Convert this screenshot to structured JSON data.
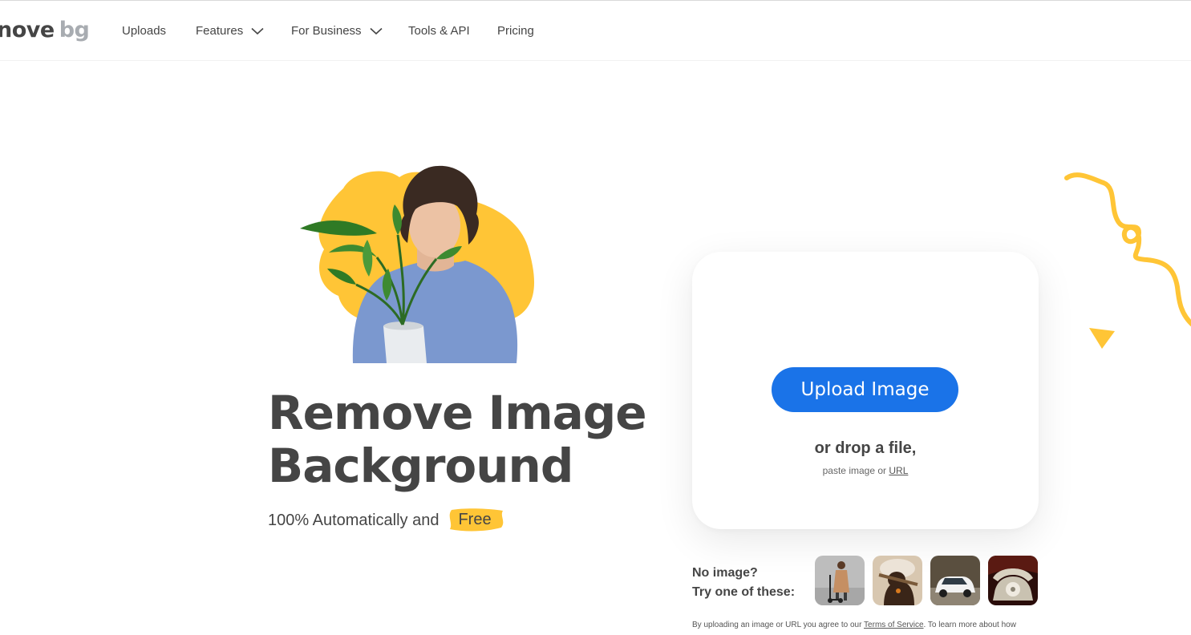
{
  "header": {
    "logo_main": "nove",
    "logo_accent": "bg",
    "nav": [
      {
        "label": "Uploads",
        "has_dropdown": false
      },
      {
        "label": "Features",
        "has_dropdown": true
      },
      {
        "label": "For Business",
        "has_dropdown": true
      },
      {
        "label": "Tools & API",
        "has_dropdown": false
      },
      {
        "label": "Pricing",
        "has_dropdown": false
      }
    ]
  },
  "hero": {
    "title_line1": "Remove Image",
    "title_line2": "Background",
    "subtitle": "100% Automatically and",
    "free_badge": "Free",
    "illustration_icon": "person-holding-plant-illustration"
  },
  "upload_card": {
    "button_label": "Upload Image",
    "drop_text": "or drop a file,",
    "paste_prefix": "paste image or",
    "paste_link": "URL"
  },
  "samples": {
    "line1": "No image?",
    "line2": "Try one of these:",
    "items": [
      {
        "icon": "woman-with-scooter-thumbnail"
      },
      {
        "icon": "dog-with-stick-thumbnail"
      },
      {
        "icon": "white-car-thumbnail"
      },
      {
        "icon": "rotary-phone-thumbnail"
      }
    ]
  },
  "footer": {
    "terms_prefix": "By uploading an image or URL you agree to our",
    "terms_link": "Terms of Service",
    "terms_suffix": ". To learn more about how"
  },
  "colors": {
    "accent_blue": "#1a73e8",
    "accent_yellow": "#ffc536",
    "text_dark": "#454545"
  }
}
